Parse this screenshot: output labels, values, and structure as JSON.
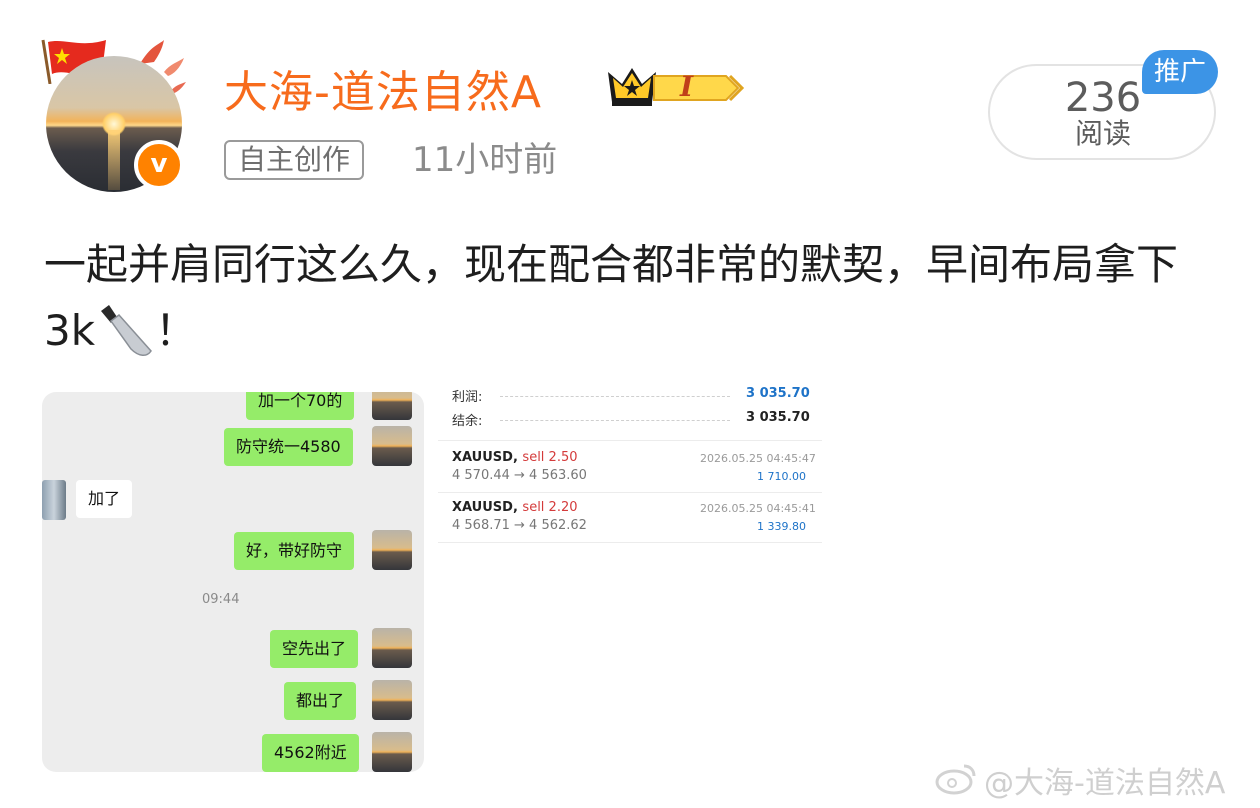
{
  "header": {
    "username": "大海-道法自然A",
    "level_badge": "I",
    "tag": "自主创作",
    "time": "11小时前"
  },
  "read": {
    "count": "236",
    "label": "阅读",
    "promo": "推广"
  },
  "post": {
    "text_before": "一起并肩同行这么久，现在配合都非常的默契，早间布局拿下 3k",
    "text_after": "！"
  },
  "chat": {
    "messages": [
      {
        "side": "right",
        "text": "加一个70的"
      },
      {
        "side": "right",
        "text": "防守统一4580"
      },
      {
        "side": "left",
        "text": "加了"
      },
      {
        "side": "right",
        "text": "好，带好防守"
      },
      {
        "side": "right",
        "text": "空先出了"
      },
      {
        "side": "right",
        "text": "都出了"
      },
      {
        "side": "right",
        "text": "4562附近"
      }
    ],
    "time": "09:44"
  },
  "trade": {
    "profit_label": "利润:",
    "profit_value": "3 035.70",
    "balance_label": "结余:",
    "balance_value": "3 035.70",
    "orders": [
      {
        "symbol": "XAUUSD,",
        "side": "sell 2.50",
        "prices": "4 570.44 → 4 563.60",
        "timestamp": "2026.05.25 04:45:47",
        "profit": "1 710.00"
      },
      {
        "symbol": "XAUUSD,",
        "side": "sell 2.20",
        "prices": "4 568.71 → 4 562.62",
        "timestamp": "2026.05.25 04:45:41",
        "profit": "1 339.80"
      }
    ]
  },
  "watermark": "@大海-道法自然A",
  "colors": {
    "username": "#f76b1c",
    "promo": "#3c94e6",
    "chat_bubble": "#95ec69",
    "verified_badge": "#ff8200"
  },
  "icons": [
    "china-flag-icon",
    "bird-icon",
    "crown-icon",
    "verified-icon",
    "knife-icon",
    "weibo-icon"
  ]
}
